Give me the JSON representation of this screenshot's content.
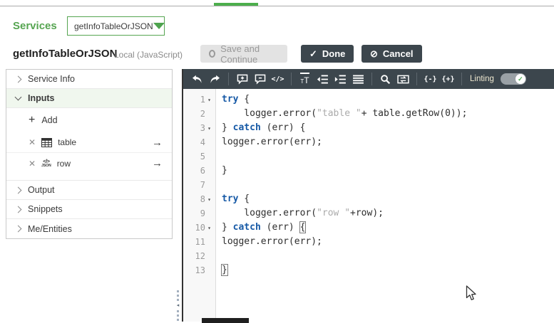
{
  "services_bar": {
    "label": "Services",
    "dropdown_value": "getInfoTableOrJSON"
  },
  "header": {
    "title": "getInfoTableOrJSON",
    "subtitle": "Local (JavaScript)",
    "save_button": "Save and Continue",
    "done_button": "Done",
    "cancel_button": "Cancel"
  },
  "sidebar": {
    "sections": {
      "service_info": "Service Info",
      "inputs": "Inputs",
      "output": "Output",
      "snippets": "Snippets",
      "me_entities": "Me/Entities"
    },
    "inputs_panel": {
      "add_label": "Add",
      "items": [
        {
          "name": "table",
          "type": "infotable"
        },
        {
          "name": "row",
          "type": "json"
        }
      ],
      "json_icon_top": "</>",
      "json_icon_bottom": "JSON"
    }
  },
  "editor": {
    "toolbar": {
      "icon_names": [
        "undo",
        "redo",
        "comment-add",
        "comment-remove",
        "code",
        "font-size",
        "outdent",
        "indent",
        "align-lines",
        "search",
        "replace",
        "fold-braces",
        "unfold-braces"
      ],
      "code_icon_label": "</>",
      "fold_label": "{-}",
      "unfold_label": "{+}",
      "linting_label": "Linting",
      "linting_enabled": true
    },
    "code": {
      "language": "JavaScript",
      "lines": [
        {
          "num": 1,
          "fold": true,
          "segs": [
            [
              "try",
              "kw"
            ],
            [
              " {",
              ""
            ]
          ]
        },
        {
          "num": 2,
          "fold": false,
          "segs": [
            [
              "    logger.error(",
              ""
            ],
            [
              "\"table \"",
              "str"
            ],
            [
              "+ table.getRow(0));",
              ""
            ]
          ]
        },
        {
          "num": 3,
          "fold": true,
          "segs": [
            [
              "} ",
              ""
            ],
            [
              "catch",
              "kw"
            ],
            [
              " (err) {",
              ""
            ]
          ]
        },
        {
          "num": 4,
          "fold": false,
          "segs": [
            [
              "logger.error(err);",
              ""
            ]
          ]
        },
        {
          "num": 5,
          "fold": false,
          "segs": []
        },
        {
          "num": 6,
          "fold": false,
          "segs": [
            [
              "}",
              ""
            ]
          ]
        },
        {
          "num": 7,
          "fold": false,
          "segs": []
        },
        {
          "num": 8,
          "fold": true,
          "segs": [
            [
              "try",
              "kw"
            ],
            [
              " {",
              ""
            ]
          ]
        },
        {
          "num": 9,
          "fold": false,
          "segs": [
            [
              "    logger.error(",
              ""
            ],
            [
              "\"row \"",
              "str"
            ],
            [
              "+row);",
              ""
            ]
          ]
        },
        {
          "num": 10,
          "fold": true,
          "segs": [
            [
              "} ",
              ""
            ],
            [
              "catch",
              "kw"
            ],
            [
              " (err) ",
              ""
            ],
            [
              "{",
              "match"
            ]
          ]
        },
        {
          "num": 11,
          "fold": false,
          "segs": [
            [
              "logger.error(err);",
              ""
            ]
          ]
        },
        {
          "num": 12,
          "fold": false,
          "segs": []
        },
        {
          "num": 13,
          "fold": false,
          "segs": [
            [
              "}",
              "match"
            ]
          ],
          "cursor": true
        }
      ]
    }
  },
  "colors": {
    "accent_green": "#56a551",
    "toolbar_bg": "#3c464d",
    "keyword_blue": "#1659a6",
    "string_gray": "#ababab",
    "inputs_highlight": "#f0f7ee"
  }
}
